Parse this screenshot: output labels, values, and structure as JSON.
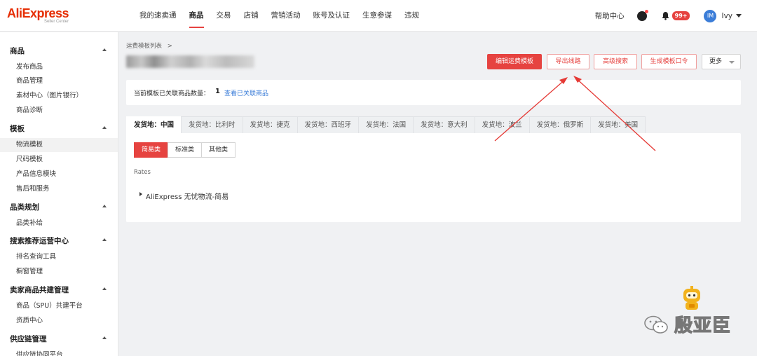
{
  "brand": {
    "name": "AliExpress",
    "subtitle": "Seller Center"
  },
  "nav": {
    "items": [
      "我的速卖通",
      "商品",
      "交易",
      "店铺",
      "营销活动",
      "账号及认证",
      "生意参谋",
      "违规"
    ],
    "active_index": 1
  },
  "topbar": {
    "help": "帮助中心",
    "notifications": "99+",
    "avatar_text": "IM",
    "user": "Ivy"
  },
  "sidebar": {
    "sections": [
      {
        "title": "商品",
        "items": [
          "发布商品",
          "商品管理",
          "素材中心（图片银行）",
          "商品诊断"
        ]
      },
      {
        "title": "模板",
        "items": [
          "物流模板",
          "尺码模板",
          "产品信息模块",
          "售后和服务"
        ]
      },
      {
        "title": "品类规划",
        "items": [
          "品类补给"
        ]
      },
      {
        "title": "搜索推荐运营中心",
        "items": [
          "排名查询工具",
          "橱窗管理"
        ]
      },
      {
        "title": "卖家商品共建管理",
        "items": [
          "商品（SPU）共建平台",
          "资质中心"
        ]
      },
      {
        "title": "供应链管理",
        "items": [
          "供应链协同平台"
        ]
      }
    ],
    "active_item": "物流模板"
  },
  "breadcrumb": {
    "label": "运费模板列表",
    "sep": ">"
  },
  "actions": {
    "edit": "编辑运费模板",
    "export": "导出线路",
    "search": "高级搜索",
    "generate": "生成模板口令",
    "more": "更多"
  },
  "info": {
    "label": "当前模板已关联商品数量：",
    "count": "1",
    "link": "查看已关联商品"
  },
  "origin_tabs": [
    "发货地：中国",
    "发货地：比利时",
    "发货地：捷克",
    "发货地：西班牙",
    "发货地：法国",
    "发货地：意大利",
    "发货地：波兰",
    "发货地：俄罗斯",
    "发货地：美国"
  ],
  "active_origin_index": 0,
  "segments": [
    "简易类",
    "标准类",
    "其他类"
  ],
  "active_segment_index": 0,
  "rates_label": "Rates",
  "logistics_line": "AliExpress 无忧物流-简易",
  "watermark": "殷亚臣",
  "colors": {
    "accent": "#e64340",
    "link": "#3b7dd8",
    "annotation": "#e53935"
  }
}
